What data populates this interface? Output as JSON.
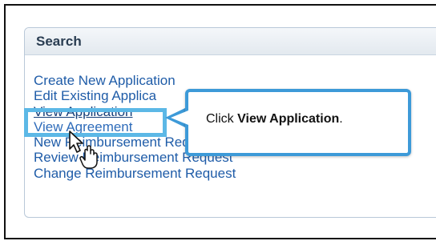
{
  "panel": {
    "title": "Search"
  },
  "links": [
    "Create New Application",
    "Edit Existing Applica",
    "View Application",
    "View Agreement",
    "New Reimbursement Request",
    "Review Reimbursement Request",
    "Change Reimbursement Request"
  ],
  "callout": {
    "prefix": "Click ",
    "bold": "View Application",
    "suffix": "."
  },
  "icons": {
    "cursor": "hand-pointer-icon"
  },
  "colors": {
    "link": "#1f5ca8",
    "highlight": "#5cb8e6",
    "callout_border": "#3d9ad8"
  }
}
